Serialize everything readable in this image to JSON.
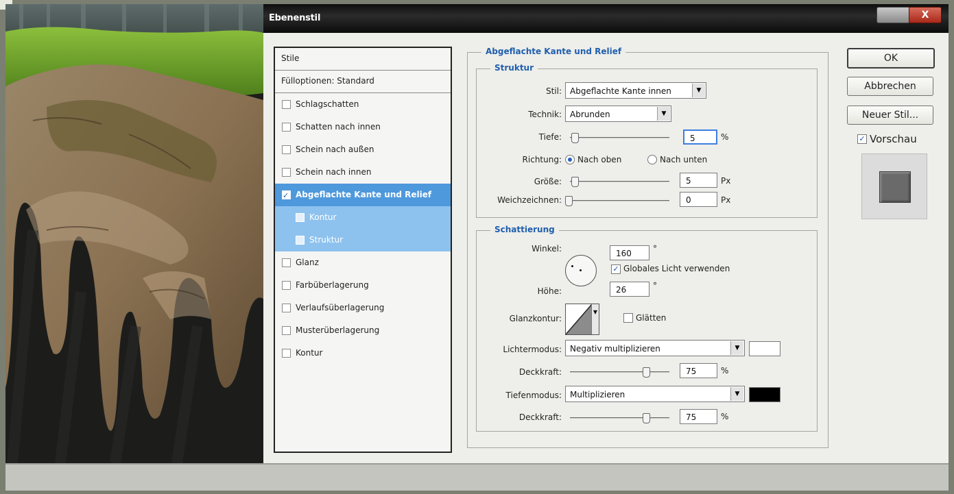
{
  "dialog": {
    "title": "Ebenenstil",
    "close_label": "X"
  },
  "style_list": {
    "header": "Stile",
    "blend_options": "Fülloptionen: Standard",
    "items": [
      {
        "label": "Schlagschatten",
        "checked": false
      },
      {
        "label": "Schatten nach innen",
        "checked": false
      },
      {
        "label": "Schein nach außen",
        "checked": false
      },
      {
        "label": "Schein nach innen",
        "checked": false
      },
      {
        "label": "Abgeflachte Kante und Relief",
        "checked": true,
        "selected": true
      },
      {
        "label": "Kontur",
        "checked": false,
        "sub": true
      },
      {
        "label": "Struktur",
        "checked": false,
        "sub": true
      },
      {
        "label": "Glanz",
        "checked": false
      },
      {
        "label": "Farbüberlagerung",
        "checked": false
      },
      {
        "label": "Verlaufsüberlagerung",
        "checked": false
      },
      {
        "label": "Musterüberlagerung",
        "checked": false
      },
      {
        "label": "Kontur",
        "checked": false
      }
    ]
  },
  "bevel": {
    "section_title": "Abgeflachte Kante und Relief",
    "structure": {
      "title": "Struktur",
      "style_label": "Stil:",
      "style_value": "Abgeflachte Kante innen",
      "technique_label": "Technik:",
      "technique_value": "Abrunden",
      "depth_label": "Tiefe:",
      "depth_value": "5",
      "depth_unit": "%",
      "direction_label": "Richtung:",
      "direction_up": "Nach oben",
      "direction_down": "Nach unten",
      "direction_selected": "up",
      "size_label": "Größe:",
      "size_value": "5",
      "size_unit": "Px",
      "soften_label": "Weichzeichnen:",
      "soften_value": "0",
      "soften_unit": "Px"
    },
    "shading": {
      "title": "Schattierung",
      "angle_label": "Winkel:",
      "angle_value": "160",
      "angle_unit": "°",
      "global_light_label": "Globales Licht verwenden",
      "global_light_checked": true,
      "altitude_label": "Höhe:",
      "altitude_value": "26",
      "altitude_unit": "°",
      "gloss_contour_label": "Glanzkontur:",
      "anti_alias_label": "Glätten",
      "anti_alias_checked": false,
      "highlight_mode_label": "Lichtermodus:",
      "highlight_mode_value": "Negativ multiplizieren",
      "highlight_color": "#ffffff",
      "highlight_opacity_label": "Deckkraft:",
      "highlight_opacity_value": "75",
      "highlight_opacity_unit": "%",
      "shadow_mode_label": "Tiefenmodus:",
      "shadow_mode_value": "Multiplizieren",
      "shadow_color": "#000000",
      "shadow_opacity_label": "Deckkraft:",
      "shadow_opacity_value": "75",
      "shadow_opacity_unit": "%"
    }
  },
  "buttons": {
    "ok": "OK",
    "cancel": "Abbrechen",
    "new_style": "Neuer Stil...",
    "preview_label": "Vorschau",
    "preview_checked": true
  }
}
